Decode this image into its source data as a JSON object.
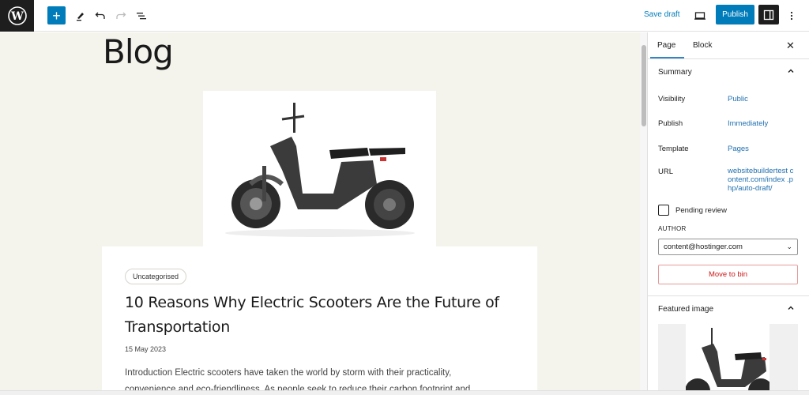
{
  "toolbar": {
    "add_block_label": "+",
    "save_draft": "Save draft",
    "publish": "Publish",
    "icons": [
      "wordpress-logo",
      "plus-icon",
      "pencil-icon",
      "undo-icon",
      "redo-icon",
      "list-view-icon",
      "desktop-preview-icon",
      "settings-sidebar-icon",
      "more-options-icon"
    ]
  },
  "canvas": {
    "page_title": "Blog",
    "post": {
      "category": "Uncategorised",
      "title": "10 Reasons Why Electric Scooters Are the Future of Transportation",
      "date": "15 May 2023",
      "excerpt": "Introduction Electric scooters have taken the world by storm with their practicality, convenience and eco-friendliness. As people seek to reduce their carbon footprint and"
    }
  },
  "sidebar": {
    "tabs": [
      {
        "label": "Page",
        "active": true
      },
      {
        "label": "Block",
        "active": false
      }
    ],
    "summary": {
      "title": "Summary",
      "rows": [
        {
          "label": "Visibility",
          "value": "Public"
        },
        {
          "label": "Publish",
          "value": "Immediately"
        },
        {
          "label": "Template",
          "value": "Pages"
        },
        {
          "label": "URL",
          "value": "websitebuildertest content.com/index .php/auto-draft/"
        }
      ],
      "pending_review_label": "Pending review",
      "pending_review_checked": false,
      "author_label": "AUTHOR",
      "author_value": "content@hostinger.com",
      "move_to_bin": "Move to bin"
    },
    "featured_image": {
      "title": "Featured image"
    }
  },
  "colors": {
    "accent": "#007cba",
    "link": "#2271b1",
    "danger": "#cc1818",
    "canvas_bg": "#f5f4ec",
    "dark": "#1e1e1e"
  }
}
